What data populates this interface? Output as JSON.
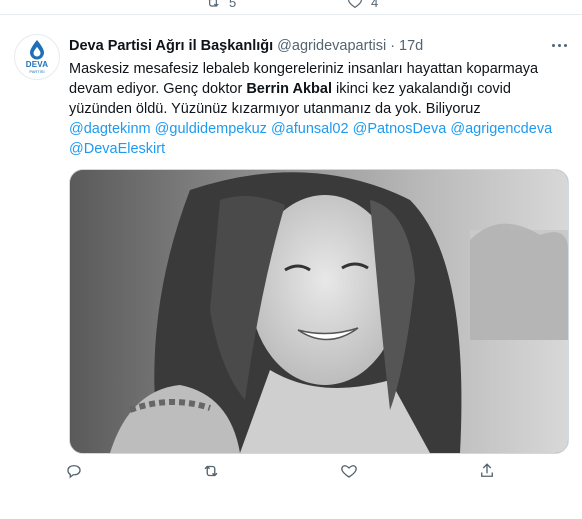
{
  "top_actions": {
    "retweet_count": "5",
    "like_count": "4"
  },
  "tweet": {
    "author_name": "Deva Partisi Ağrı il Başkanlığı",
    "author_handle": "@agridevapartisi",
    "separator": "·",
    "time": "17d",
    "avatar_brand": "DEVA",
    "avatar_brand_sub": "PARTİSİ",
    "text_part1": "Maskesiz mesafesiz lebaleb kongereleriniz insanları hayattan koparmaya devam ediyor. Genç doktor ",
    "text_bold": "Berrin Akbal",
    "text_part2": " ikinci kez yakalandığı covid yüzünden öldü. Yüzünüz kızarmıyor utanmanız da yok. Biliyoruz",
    "mentions": [
      "@dagtekinm",
      "@guldidempekuz",
      "@afunsal02",
      "@PatnosDeva",
      "@agrigencdeva",
      "@DevaEleskirt"
    ],
    "image_alt": "black and white photo of a smiling young woman"
  },
  "colors": {
    "mention": "#1d9bf0",
    "brand_blue": "#1f6fb8",
    "muted": "#536471"
  },
  "icons": [
    "retweet-icon",
    "like-icon",
    "reply-icon",
    "share-icon",
    "more-icon",
    "deva-drop-icon"
  ]
}
